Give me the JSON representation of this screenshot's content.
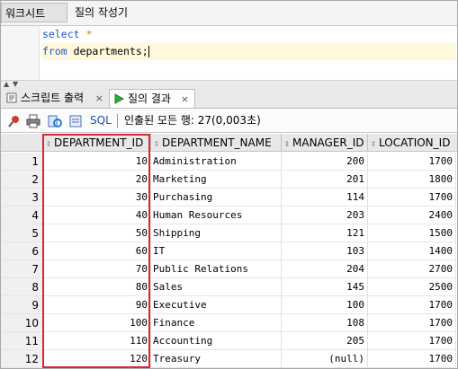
{
  "tabs": {
    "worksheet": "워크시트",
    "query_builder": "질의 작성기"
  },
  "editor": {
    "line1_kw": "select",
    "line1_rest": " *",
    "line2_kw": "from",
    "line2_rest": " departments;"
  },
  "result_tabs": {
    "script_output": "스크립트 출력",
    "query_result": "질의 결과",
    "close_symbol": "×"
  },
  "toolbar": {
    "sql_label": "SQL",
    "fetch_status": "인출된 모든 행: 27(0,003초)"
  },
  "table": {
    "columns": [
      "DEPARTMENT_ID",
      "DEPARTMENT_NAME",
      "MANAGER_ID",
      "LOCATION_ID"
    ],
    "rows": [
      {
        "n": "1",
        "id": "10",
        "name": "Administration",
        "mgr": "200",
        "loc": "1700"
      },
      {
        "n": "2",
        "id": "20",
        "name": "Marketing",
        "mgr": "201",
        "loc": "1800"
      },
      {
        "n": "3",
        "id": "30",
        "name": "Purchasing",
        "mgr": "114",
        "loc": "1700"
      },
      {
        "n": "4",
        "id": "40",
        "name": "Human Resources",
        "mgr": "203",
        "loc": "2400"
      },
      {
        "n": "5",
        "id": "50",
        "name": "Shipping",
        "mgr": "121",
        "loc": "1500"
      },
      {
        "n": "6",
        "id": "60",
        "name": "IT",
        "mgr": "103",
        "loc": "1400"
      },
      {
        "n": "7",
        "id": "70",
        "name": "Public Relations",
        "mgr": "204",
        "loc": "2700"
      },
      {
        "n": "8",
        "id": "80",
        "name": "Sales",
        "mgr": "145",
        "loc": "2500"
      },
      {
        "n": "9",
        "id": "90",
        "name": "Executive",
        "mgr": "100",
        "loc": "1700"
      },
      {
        "n": "10",
        "id": "100",
        "name": "Finance",
        "mgr": "108",
        "loc": "1700"
      },
      {
        "n": "11",
        "id": "110",
        "name": "Accounting",
        "mgr": "205",
        "loc": "1700"
      },
      {
        "n": "12",
        "id": "120",
        "name": "Treasury",
        "mgr": "(null)",
        "loc": "1700"
      }
    ]
  },
  "colors": {
    "highlight": "#d9282f",
    "keyword": "#1a55c4"
  }
}
